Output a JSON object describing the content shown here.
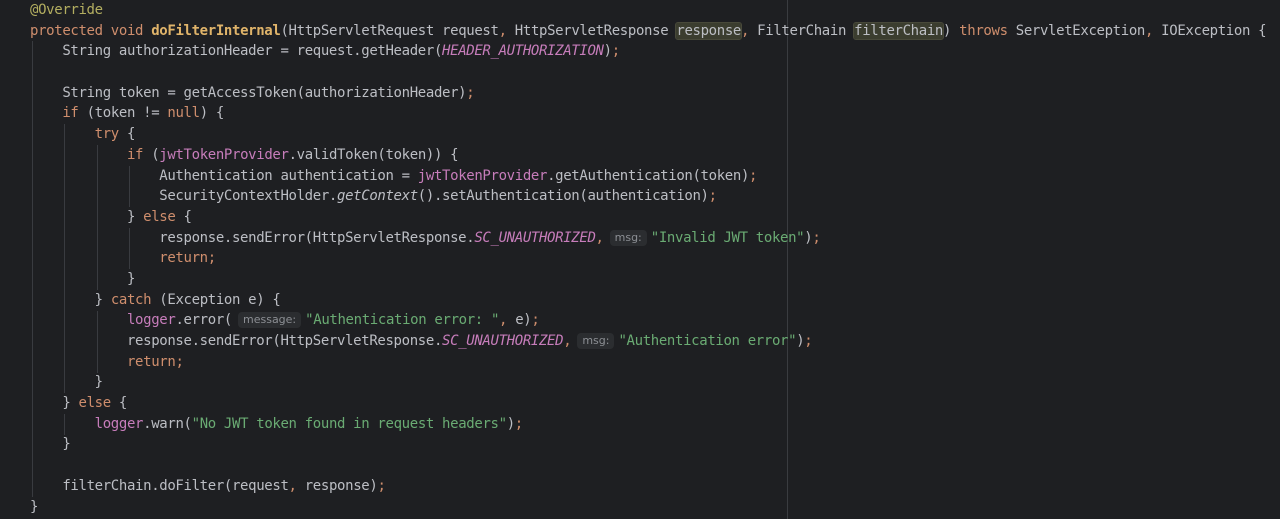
{
  "editor": {
    "lines": [
      {
        "indent": 0,
        "tokens": [
          {
            "t": "@Override",
            "c": "annot"
          }
        ]
      },
      {
        "indent": 0,
        "tokens": [
          {
            "t": "protected ",
            "c": "kw"
          },
          {
            "t": "void ",
            "c": "kw"
          },
          {
            "t": "doFilterInternal",
            "c": "fndecl"
          },
          {
            "t": "(HttpServletRequest request",
            "c": "plain"
          },
          {
            "t": ", ",
            "c": "semi"
          },
          {
            "t": "HttpServletResponse ",
            "c": "plain"
          },
          {
            "t": "response",
            "c": "hl"
          },
          {
            "t": ", ",
            "c": "semi"
          },
          {
            "t": "FilterChain ",
            "c": "plain"
          },
          {
            "t": "filterChain",
            "c": "hl"
          },
          {
            "t": ") ",
            "c": "plain"
          },
          {
            "t": "throws ",
            "c": "kw"
          },
          {
            "t": "ServletException",
            "c": "plain"
          },
          {
            "t": ", ",
            "c": "semi"
          },
          {
            "t": "IOException {",
            "c": "plain"
          }
        ]
      },
      {
        "indent": 1,
        "tokens": [
          {
            "t": "String authorizationHeader = request.getHeader(",
            "c": "plain"
          },
          {
            "t": "HEADER_AUTHORIZATION",
            "c": "static"
          },
          {
            "t": ")",
            "c": "plain"
          },
          {
            "t": ";",
            "c": "semi"
          }
        ]
      },
      {
        "indent": 0,
        "tokens": []
      },
      {
        "indent": 1,
        "tokens": [
          {
            "t": "String token = getAccessToken(authorizationHeader)",
            "c": "plain"
          },
          {
            "t": ";",
            "c": "semi"
          }
        ]
      },
      {
        "indent": 1,
        "tokens": [
          {
            "t": "if ",
            "c": "kw"
          },
          {
            "t": "(token != ",
            "c": "plain"
          },
          {
            "t": "null",
            "c": "kw"
          },
          {
            "t": ") {",
            "c": "plain"
          }
        ]
      },
      {
        "indent": 2,
        "tokens": [
          {
            "t": "try ",
            "c": "kw"
          },
          {
            "t": "{",
            "c": "plain"
          }
        ]
      },
      {
        "indent": 3,
        "tokens": [
          {
            "t": "if ",
            "c": "kw"
          },
          {
            "t": "(",
            "c": "plain"
          },
          {
            "t": "jwtTokenProvider",
            "c": "field"
          },
          {
            "t": ".validToken(token)) {",
            "c": "plain"
          }
        ]
      },
      {
        "indent": 4,
        "tokens": [
          {
            "t": "Authentication authentication = ",
            "c": "plain"
          },
          {
            "t": "jwtTokenProvider",
            "c": "field"
          },
          {
            "t": ".getAuthentication(token)",
            "c": "plain"
          },
          {
            "t": ";",
            "c": "semi"
          }
        ]
      },
      {
        "indent": 4,
        "tokens": [
          {
            "t": "SecurityContextHolder.",
            "c": "plain"
          },
          {
            "t": "getContext",
            "c": "italic"
          },
          {
            "t": "().setAuthentication(authentication)",
            "c": "plain"
          },
          {
            "t": ";",
            "c": "semi"
          }
        ]
      },
      {
        "indent": 3,
        "tokens": [
          {
            "t": "} ",
            "c": "plain"
          },
          {
            "t": "else ",
            "c": "kw"
          },
          {
            "t": "{",
            "c": "plain"
          }
        ]
      },
      {
        "indent": 4,
        "tokens": [
          {
            "t": "response.sendError(HttpServletResponse.",
            "c": "plain"
          },
          {
            "t": "SC_UNAUTHORIZED",
            "c": "static"
          },
          {
            "t": ",",
            "c": "semi"
          },
          {
            "t": "msg:",
            "c": "hint"
          },
          {
            "t": "\"Invalid JWT token\"",
            "c": "str"
          },
          {
            "t": ")",
            "c": "plain"
          },
          {
            "t": ";",
            "c": "semi"
          }
        ]
      },
      {
        "indent": 4,
        "tokens": [
          {
            "t": "return",
            "c": "kw"
          },
          {
            "t": ";",
            "c": "semi"
          }
        ]
      },
      {
        "indent": 3,
        "tokens": [
          {
            "t": "}",
            "c": "plain"
          }
        ]
      },
      {
        "indent": 2,
        "tokens": [
          {
            "t": "} ",
            "c": "plain"
          },
          {
            "t": "catch ",
            "c": "kw"
          },
          {
            "t": "(Exception e) {",
            "c": "plain"
          }
        ]
      },
      {
        "indent": 3,
        "tokens": [
          {
            "t": "logger",
            "c": "field"
          },
          {
            "t": ".error(",
            "c": "plain"
          },
          {
            "t": "message:",
            "c": "hint"
          },
          {
            "t": "\"Authentication error: \"",
            "c": "str"
          },
          {
            "t": ", ",
            "c": "semi"
          },
          {
            "t": "e)",
            "c": "plain"
          },
          {
            "t": ";",
            "c": "semi"
          }
        ]
      },
      {
        "indent": 3,
        "tokens": [
          {
            "t": "response.sendError(HttpServletResponse.",
            "c": "plain"
          },
          {
            "t": "SC_UNAUTHORIZED",
            "c": "static"
          },
          {
            "t": ",",
            "c": "semi"
          },
          {
            "t": "msg:",
            "c": "hint"
          },
          {
            "t": "\"Authentication error\"",
            "c": "str"
          },
          {
            "t": ")",
            "c": "plain"
          },
          {
            "t": ";",
            "c": "semi"
          }
        ]
      },
      {
        "indent": 3,
        "tokens": [
          {
            "t": "return",
            "c": "kw"
          },
          {
            "t": ";",
            "c": "semi"
          }
        ]
      },
      {
        "indent": 2,
        "tokens": [
          {
            "t": "}",
            "c": "plain"
          }
        ]
      },
      {
        "indent": 1,
        "tokens": [
          {
            "t": "} ",
            "c": "plain"
          },
          {
            "t": "else ",
            "c": "kw"
          },
          {
            "t": "{",
            "c": "plain"
          }
        ]
      },
      {
        "indent": 2,
        "tokens": [
          {
            "t": "logger",
            "c": "field"
          },
          {
            "t": ".warn(",
            "c": "plain"
          },
          {
            "t": "\"No JWT token found in request headers\"",
            "c": "str"
          },
          {
            "t": ")",
            "c": "plain"
          },
          {
            "t": ";",
            "c": "semi"
          }
        ]
      },
      {
        "indent": 1,
        "tokens": [
          {
            "t": "}",
            "c": "plain"
          }
        ]
      },
      {
        "indent": 0,
        "tokens": []
      },
      {
        "indent": 1,
        "tokens": [
          {
            "t": "filterChain.doFilter(request",
            "c": "plain"
          },
          {
            "t": ", ",
            "c": "semi"
          },
          {
            "t": "response)",
            "c": "plain"
          },
          {
            "t": ";",
            "c": "semi"
          }
        ]
      },
      {
        "indent": 0,
        "tokens": [
          {
            "t": "}",
            "c": "plain"
          }
        ]
      }
    ]
  },
  "colors": {
    "background": "#1e1f22",
    "plain": "#bcbec4",
    "keyword": "#cf8e6d",
    "annotation": "#b3ae60",
    "declared_method": "#e0b46a",
    "field": "#c77dbb",
    "string": "#6aab73",
    "inlay_hint": "#8c8f94"
  }
}
